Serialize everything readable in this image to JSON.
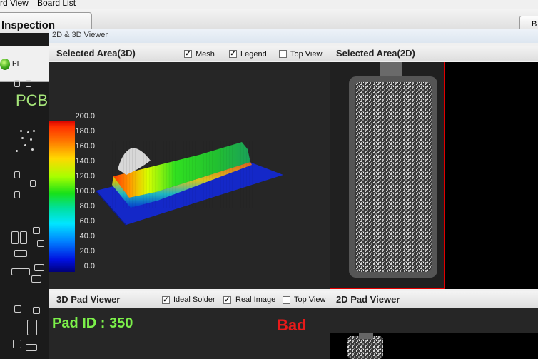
{
  "menubar": {
    "items": [
      "rd View",
      "Board List"
    ]
  },
  "app_header": {
    "title": "Inspection",
    "right_button": "B"
  },
  "left_panel": {
    "indicator_label": "PI",
    "board_label": "PCB"
  },
  "viewer": {
    "title": "2D & 3D Viewer",
    "selected_3d": {
      "title": "Selected Area(3D)",
      "options": [
        {
          "label": "Mesh",
          "checked": true
        },
        {
          "label": "Legend",
          "checked": true
        },
        {
          "label": "Top View",
          "checked": false
        }
      ],
      "legend_ticks": [
        "200.0",
        "180.0",
        "160.0",
        "140.0",
        "120.0",
        "100.0",
        "80.0",
        "60.0",
        "40.0",
        "20.0",
        "0.0"
      ]
    },
    "selected_2d": {
      "title": "Selected Area(2D)"
    },
    "pad_3d": {
      "title": "3D Pad Viewer",
      "options": [
        {
          "label": "Ideal Solder",
          "checked": true
        },
        {
          "label": "Real Image",
          "checked": true
        },
        {
          "label": "Top View",
          "checked": false
        }
      ],
      "pad_id": "Pad ID : 350",
      "result": "Bad"
    },
    "pad_2d": {
      "title": "2D Pad Viewer"
    }
  },
  "colors": {
    "pad_id": "#7cf04a",
    "result_bad": "#e81a1a",
    "board_label": "#a6e67a",
    "selection_border": "#e00000"
  }
}
